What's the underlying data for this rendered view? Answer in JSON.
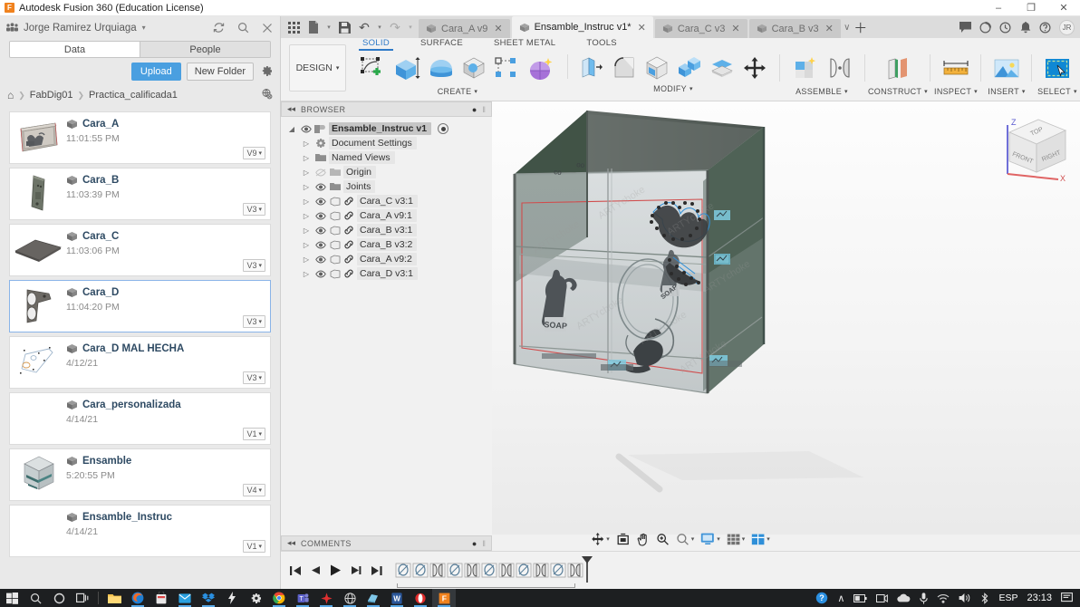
{
  "window": {
    "app_title": "Autodesk Fusion 360 (Education License)",
    "logo_letter": "F",
    "minimize": "–",
    "maximize": "❐",
    "close": "✕"
  },
  "data_panel": {
    "user_name": "Jorge Ramirez Urquiaga",
    "user_caret": "▾",
    "refresh_icon": "⟳",
    "search_icon": "⌕",
    "close_icon": "✕",
    "tabs": [
      {
        "label": "Data",
        "active": true
      },
      {
        "label": "People",
        "active": false
      }
    ],
    "upload_label": "Upload",
    "new_folder_label": "New Folder",
    "gear_icon": "⚙",
    "breadcrumb": {
      "home_icon": "⌂",
      "sep": "❯",
      "items": [
        "FabDig01",
        "Practica_calificada1"
      ],
      "right_icon": "⚇"
    },
    "files": [
      {
        "name": "Cara_A",
        "date": "11:01:55 PM",
        "version": "V9",
        "selected": false,
        "thumb": "plate-a"
      },
      {
        "name": "Cara_B",
        "date": "11:03:39 PM",
        "version": "V3",
        "selected": false,
        "thumb": "plate-b"
      },
      {
        "name": "Cara_C",
        "date": "11:03:06 PM",
        "version": "V3",
        "selected": false,
        "thumb": "plate-c"
      },
      {
        "name": "Cara_D",
        "date": "11:04:20 PM",
        "version": "V3",
        "selected": true,
        "thumb": "bracket"
      },
      {
        "name": "Cara_D MAL HECHA",
        "date": "4/12/21",
        "version": "V3",
        "selected": false,
        "thumb": "sketch"
      },
      {
        "name": "Cara_personalizada",
        "date": "4/14/21",
        "version": "V1",
        "selected": false,
        "thumb": "none"
      },
      {
        "name": "Ensamble",
        "date": "5:20:55 PM",
        "version": "V4",
        "selected": false,
        "thumb": "box"
      },
      {
        "name": "Ensamble_Instruc",
        "date": "4/14/21",
        "version": "V1",
        "selected": false,
        "thumb": "none"
      }
    ],
    "version_caret": "▾"
  },
  "quick_access": {
    "grid_icon": "☷",
    "file_icon": "file-icon",
    "save_icon": "save-icon",
    "undo_icon": "↶",
    "redo_icon": "↷",
    "caret": "▾",
    "doc_tabs": [
      {
        "label": "Cara_A v9",
        "active": false,
        "close": "✕"
      },
      {
        "label": "Ensamble_Instruc v1*",
        "active": true,
        "close": "✕"
      },
      {
        "label": "Cara_C v3",
        "active": false,
        "close": "✕"
      },
      {
        "label": "Cara_B v3",
        "active": false,
        "close": "✕"
      }
    ],
    "overflow_caret": "∨",
    "add_tab": "＋",
    "right_icons": [
      "comment-icon",
      "job-status-icon",
      "recent-icon",
      "notifications-icon",
      "help-icon"
    ],
    "avatar_initials": "JR"
  },
  "ribbon": {
    "workspace_label": "DESIGN",
    "workspace_caret": "▾",
    "tabs": [
      {
        "label": "SOLID",
        "active": true
      },
      {
        "label": "SURFACE",
        "active": false
      },
      {
        "label": "SHEET METAL",
        "active": false
      },
      {
        "label": "TOOLS",
        "active": false
      }
    ],
    "groups": [
      {
        "label": "CREATE",
        "caret": "▾",
        "tools": [
          "create-sketch-icon",
          "extrude-icon",
          "revolve-icon",
          "sphere-icon",
          "pattern-icon",
          "create-form-icon"
        ]
      },
      {
        "label": "MODIFY",
        "caret": "▾",
        "tools": [
          "press-pull-icon",
          "fillet-icon",
          "shell-icon",
          "combine-icon",
          "offset-face-icon",
          "move-copy-icon"
        ]
      },
      {
        "label": "ASSEMBLE",
        "caret": "▾",
        "tools": [
          "new-component-icon",
          "joint-icon"
        ]
      },
      {
        "label": "CONSTRUCT",
        "caret": "▾",
        "tools": [
          "offset-plane-icon"
        ]
      },
      {
        "label": "INSPECT",
        "caret": "▾",
        "tools": [
          "measure-icon"
        ]
      },
      {
        "label": "INSERT",
        "caret": "▾",
        "tools": [
          "insert-image-icon"
        ]
      },
      {
        "label": "SELECT",
        "caret": "▾",
        "tools": [
          "select-window-icon"
        ]
      }
    ]
  },
  "browser": {
    "collapse_icon": "◂◂",
    "title": "BROWSER",
    "dot_icon": "●",
    "grip_icon": "‖",
    "root": {
      "label": "Ensamble_Instruc v1",
      "arrow": "◢"
    },
    "nodes": [
      {
        "label": "Document Settings",
        "arrow": "▷",
        "icon": "gear-icon",
        "eye": false,
        "link": false
      },
      {
        "label": "Named Views",
        "arrow": "▷",
        "icon": "folder-icon",
        "eye": false,
        "link": false
      },
      {
        "label": "Origin",
        "arrow": "▷",
        "icon": "folder-icon",
        "eye": true,
        "eye_off": true,
        "link": false
      },
      {
        "label": "Joints",
        "arrow": "▷",
        "icon": "folder-icon",
        "eye": true,
        "link": false
      },
      {
        "label": "Cara_C v3:1",
        "arrow": "▷",
        "icon": "component-icon",
        "eye": true,
        "link": true
      },
      {
        "label": "Cara_A v9:1",
        "arrow": "▷",
        "icon": "component-icon",
        "eye": true,
        "link": true
      },
      {
        "label": "Cara_B v3:1",
        "arrow": "▷",
        "icon": "component-icon",
        "eye": true,
        "link": true
      },
      {
        "label": "Cara_B v3:2",
        "arrow": "▷",
        "icon": "component-icon",
        "eye": true,
        "link": true
      },
      {
        "label": "Cara_A v9:2",
        "arrow": "▷",
        "icon": "component-icon",
        "eye": true,
        "link": true
      },
      {
        "label": "Cara_D v3:1",
        "arrow": "▷",
        "icon": "component-icon",
        "eye": true,
        "link": true
      }
    ]
  },
  "comments": {
    "collapse_icon": "◂◂",
    "title": "COMMENTS",
    "dot_icon": "●",
    "grip_icon": "‖"
  },
  "viewcube": {
    "top_label": "TOP",
    "front_label": "FRONT",
    "right_label": "RIGHT",
    "axis_z": "Z",
    "axis_x": "X"
  },
  "navbar": {
    "items": [
      {
        "name": "orbit-icon",
        "caret": "▾"
      },
      {
        "name": "fit-icon",
        "caret": ""
      },
      {
        "name": "pan-icon",
        "caret": ""
      },
      {
        "name": "zoom-icon",
        "caret": ""
      },
      {
        "name": "zoom-window-icon",
        "caret": "▾"
      },
      {
        "name": "display-settings-icon",
        "caret": "▾"
      },
      {
        "name": "grid-snaps-icon",
        "caret": "▾"
      },
      {
        "name": "viewports-icon",
        "caret": "▾"
      }
    ]
  },
  "timeline": {
    "go_start": "◀❘",
    "step_back": "◀",
    "play": "▶",
    "step_forward": "▶",
    "go_end": "❘▶",
    "features": [
      "rigid-group-icon",
      "rigid-group-icon",
      "joint-icon",
      "rigid-group-icon",
      "joint-icon",
      "rigid-group-icon",
      "joint-icon",
      "rigid-group-icon",
      "joint-icon",
      "rigid-group-icon",
      "joint-icon"
    ]
  },
  "model": {
    "watermark_text": "ARTYchoke",
    "soap_label": "SOAP"
  },
  "taskbar": {
    "start_icon": "windows-icon",
    "items": [
      "search-icon",
      "cortana-icon",
      "task-view-icon",
      "separator",
      "file-explorer-icon",
      "firefox-icon",
      "store-icon",
      "mail-icon",
      "dropbox-icon",
      "lightning-icon",
      "settings-icon",
      "chrome-icon",
      "teams-icon",
      "autodesk-icon",
      "browser-icon",
      "onedrive-icon",
      "word-icon",
      "opera-icon",
      "fusion-icon"
    ],
    "tray": {
      "help_icon": "?",
      "chevron": "∧",
      "battery_icon": "battery-icon",
      "camera_icon": "camera-icon",
      "cloud_icon": "cloud-icon",
      "mic_icon": "mic-icon",
      "wifi_icon": "wifi-icon",
      "volume_icon": "volume-icon",
      "bluetooth_icon": "bluetooth-icon",
      "language": "ESP",
      "clock": "23:13",
      "action_center": "action-center-icon"
    }
  }
}
